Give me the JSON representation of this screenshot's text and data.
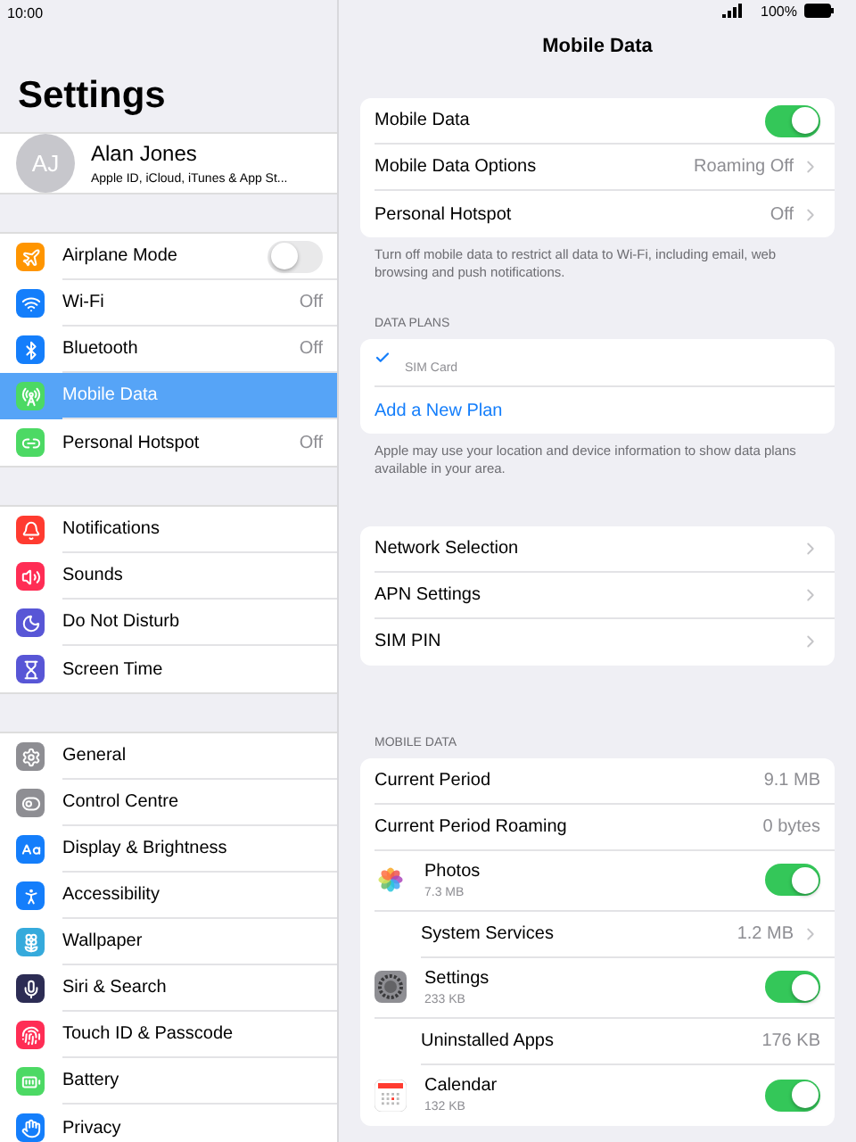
{
  "status_bar": {
    "time": "10:00",
    "battery": "100%"
  },
  "sidebar": {
    "title": "Settings",
    "profile": {
      "initials": "AJ",
      "name": "Alan Jones",
      "subtitle": "Apple ID, iCloud, iTunes & App St..."
    },
    "groups": [
      {
        "items": [
          {
            "label": "Airplane Mode",
            "kind": "toggle",
            "on": false,
            "selected": false,
            "color": "#ff9500"
          },
          {
            "label": "Wi-Fi",
            "kind": "value",
            "value": "Off",
            "selected": false,
            "color": "#147efb"
          },
          {
            "label": "Bluetooth",
            "kind": "value",
            "value": "Off",
            "selected": false,
            "color": "#147efb"
          },
          {
            "label": "Mobile Data",
            "kind": "plain",
            "selected": true,
            "color": "#4cd964"
          },
          {
            "label": "Personal Hotspot",
            "kind": "value",
            "value": "Off",
            "selected": false,
            "color": "#4cd964"
          }
        ]
      },
      {
        "items": [
          {
            "label": "Notifications",
            "kind": "plain",
            "selected": false,
            "color": "#ff3b30"
          },
          {
            "label": "Sounds",
            "kind": "plain",
            "selected": false,
            "color": "#ff2d55"
          },
          {
            "label": "Do Not Disturb",
            "kind": "plain",
            "selected": false,
            "color": "#5856d6"
          },
          {
            "label": "Screen Time",
            "kind": "plain",
            "selected": false,
            "color": "#5856d6"
          }
        ]
      },
      {
        "items": [
          {
            "label": "General",
            "kind": "plain",
            "selected": false,
            "color": "#8e8e93"
          },
          {
            "label": "Control Centre",
            "kind": "plain",
            "selected": false,
            "color": "#8e8e93"
          },
          {
            "label": "Display & Brightness",
            "kind": "plain",
            "selected": false,
            "color": "#147efb"
          },
          {
            "label": "Accessibility",
            "kind": "plain",
            "selected": false,
            "color": "#147efb"
          },
          {
            "label": "Wallpaper",
            "kind": "plain",
            "selected": false,
            "color": "#35aadc"
          },
          {
            "label": "Siri & Search",
            "kind": "plain",
            "selected": false,
            "color": "#2c2c54"
          },
          {
            "label": "Touch ID & Passcode",
            "kind": "plain",
            "selected": false,
            "color": "#ff2d55"
          },
          {
            "label": "Battery",
            "kind": "plain",
            "selected": false,
            "color": "#4cd964"
          },
          {
            "label": "Privacy",
            "kind": "plain",
            "selected": false,
            "color": "#147efb"
          }
        ]
      }
    ]
  },
  "detail": {
    "title": "Mobile Data",
    "sections": [
      {
        "rows": [
          {
            "kind": "toggle",
            "label": "Mobile Data",
            "on": true
          },
          {
            "kind": "link",
            "label": "Mobile Data Options",
            "value": "Roaming Off"
          },
          {
            "kind": "link",
            "label": "Personal Hotspot",
            "value": "Off"
          }
        ],
        "footer": "Turn off mobile data to restrict all data to Wi-Fi, including email, web browsing and push notifications."
      },
      {
        "header": "DATA PLANS",
        "rows": [
          {
            "kind": "check",
            "label": "SIM Card",
            "checked": true
          },
          {
            "kind": "action",
            "label": "Add a New Plan"
          }
        ],
        "footer": "Apple may use your location and device information to show data plans available in your area."
      },
      {
        "rows": [
          {
            "kind": "link",
            "label": "Network Selection"
          },
          {
            "kind": "link",
            "label": "APN Settings"
          },
          {
            "kind": "link",
            "label": "SIM PIN"
          }
        ]
      },
      {
        "header": "MOBILE DATA",
        "rows": [
          {
            "kind": "value",
            "label": "Current Period",
            "value": "9.1 MB"
          },
          {
            "kind": "value",
            "label": "Current Period Roaming",
            "value": "0 bytes"
          },
          {
            "kind": "app",
            "label": "Photos",
            "size": "7.3 MB",
            "on": true
          },
          {
            "kind": "link",
            "label": "System Services",
            "value": "1.2 MB",
            "indented": true
          },
          {
            "kind": "app",
            "label": "Settings",
            "size": "233 KB",
            "on": true
          },
          {
            "kind": "value",
            "label": "Uninstalled Apps",
            "value": "176 KB",
            "indented": true
          },
          {
            "kind": "app",
            "label": "Calendar",
            "size": "132 KB",
            "on": true
          }
        ]
      }
    ]
  }
}
